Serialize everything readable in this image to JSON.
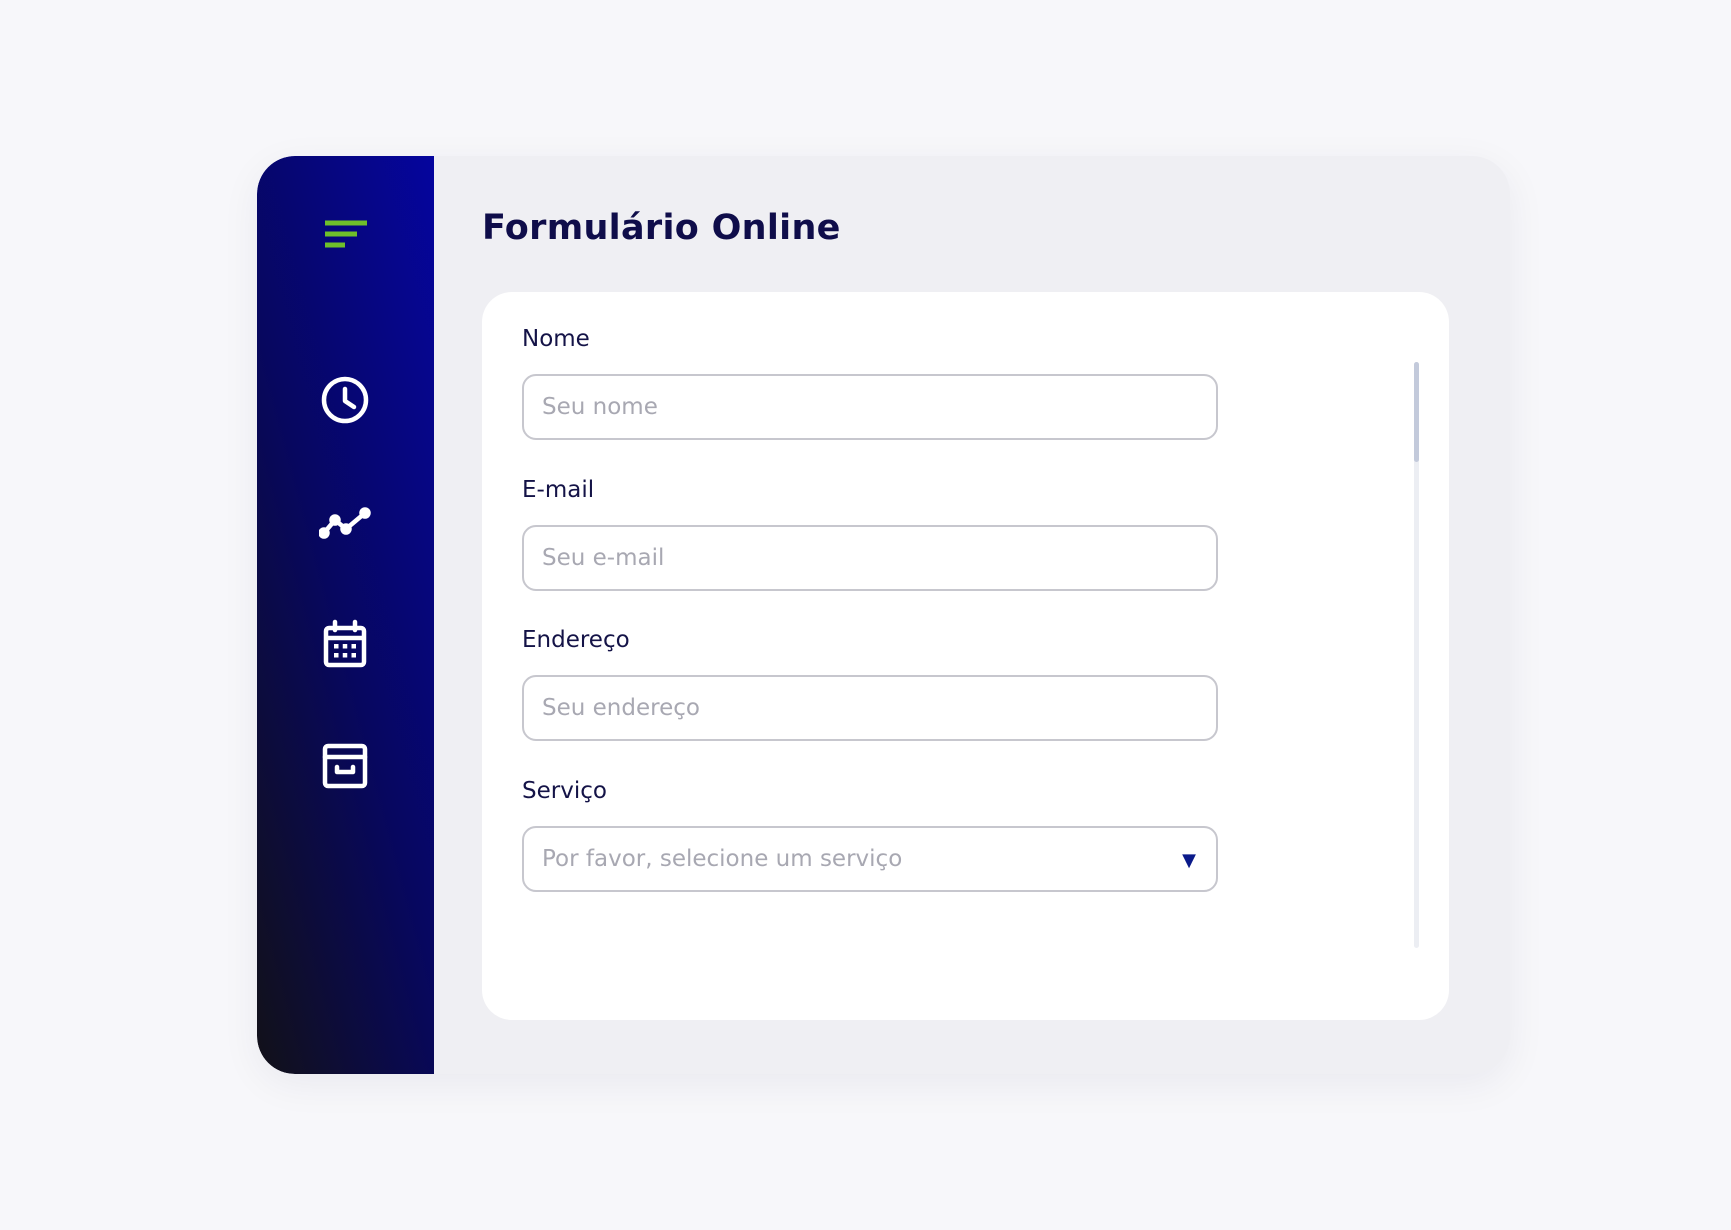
{
  "page": {
    "title": "Formulário Online"
  },
  "sidebar": {
    "items": [
      {
        "icon": "menu-icon",
        "color": "#6fbf2b"
      },
      {
        "icon": "clock-icon"
      },
      {
        "icon": "activity-chart-icon"
      },
      {
        "icon": "calendar-icon"
      },
      {
        "icon": "archive-icon"
      }
    ]
  },
  "form": {
    "fields": [
      {
        "label": "Nome",
        "placeholder": "Seu nome",
        "value": ""
      },
      {
        "label": "E-mail",
        "placeholder": "Seu e-mail",
        "value": ""
      },
      {
        "label": "Endereço",
        "placeholder": "Seu endereço",
        "value": ""
      }
    ],
    "service": {
      "label": "Serviço",
      "selected": "Por favor, selecione um serviço",
      "arrow": "▼"
    }
  },
  "colors": {
    "accent_green": "#6fbf2b",
    "title_navy": "#0f0d4a",
    "sidebar_blue": "#05059e"
  }
}
